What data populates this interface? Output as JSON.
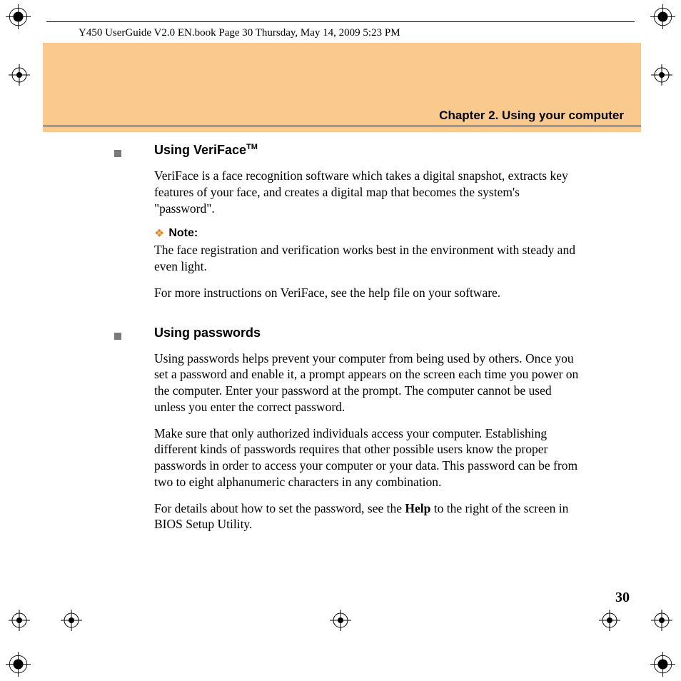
{
  "header_text": "Y450 UserGuide V2.0 EN.book  Page 30  Thursday, May 14, 2009  5:23 PM",
  "chapter_title": "Chapter 2. Using your computer",
  "section1": {
    "heading": "Using VeriFace",
    "tm": "TM",
    "p1": "VeriFace is a face recognition software which takes a digital snapshot, extracts key features of your face, and creates a digital map that becomes the system's \"password\".",
    "note_label": "Note:",
    "note_text": "The face registration and verification works best in the environment with steady and even light.",
    "p2": "For more instructions on VeriFace, see the help file on your software."
  },
  "section2": {
    "heading": "Using passwords",
    "p1": "Using passwords helps prevent your computer from being used by others. Once you set a password and enable it, a prompt appears on the screen each time you power on the computer. Enter your password at the prompt. The computer cannot be used unless you enter the correct password.",
    "p2": "Make sure that only authorized individuals access your computer. Establishing different kinds of passwords requires that other possible users know the proper passwords in order to access your computer or your data. This password can be from two to eight alphanumeric characters in any combination.",
    "p3_pre": "For details about how to set the password, see the ",
    "p3_bold": "Help",
    "p3_post": " to the right of the screen in BIOS Setup Utility."
  },
  "page_number": "30"
}
